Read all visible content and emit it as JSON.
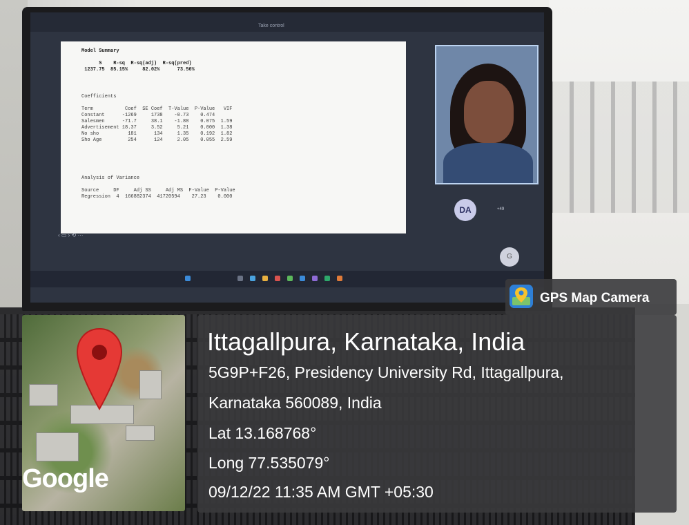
{
  "screen": {
    "meet_title": "Take control",
    "doc": {
      "model_summary": "Model Summary\n\n      S    R-sq  R-sq(adj)  R-sq(pred)\n 1237.75  85.15%     82.02%      73.56%",
      "coefficients": "Coefficients\n\nTerm           Coef  SE Coef  T-Value  P-Value   VIF\nConstant      -1269     1738    -0.73    0.474\nSalesmen      -71.7     38.1    -1.88    0.075  1.59\nAdvertisement 18.37     3.52     5.21    0.000  1.38\nNo sho          181      134     1.35    0.192  1.82\nSho Age         254      124     2.05    0.055  2.59",
      "anova": "Analysis of Variance\n\nSource     DF     Adj SS     Adj MS  F-Value  P-Value\nRegression  4  166882374  41720594    27.23    0.000"
    },
    "participant_avatar": "DA",
    "participant_more": "+49",
    "self_avatar": "G"
  },
  "overlay": {
    "app_name": "GPS Map Camera",
    "place": "Ittagallpura, Karnataka, India",
    "address_line1": "5G9P+F26, Presidency University Rd, Ittagallpura,",
    "address_line2": "Karnataka 560089, India",
    "lat": "Lat 13.168768°",
    "long": "Long 77.535079°",
    "datetime": "09/12/22 11:35 AM GMT +05:30",
    "map_brand": "Google"
  },
  "colors": {
    "overlay_bg": "#3a3a3c",
    "pin": "#e53935",
    "text": "#ffffff"
  }
}
